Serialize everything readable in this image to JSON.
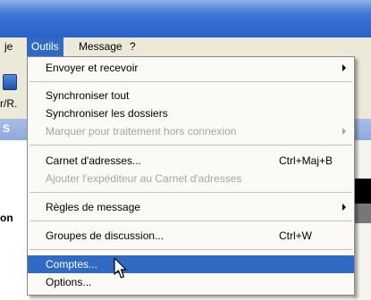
{
  "menubar": {
    "left_fragment": "je",
    "outils": "Outils",
    "message": "Message",
    "help": "?"
  },
  "toolbar": {
    "partial_label": "r/R."
  },
  "strip": {
    "letter": "S"
  },
  "left_pane": {
    "bold_fragment": "on"
  },
  "menu": {
    "items": [
      {
        "label": "Envoyer et recevoir",
        "submenu": true
      },
      {
        "label": "Synchroniser tout"
      },
      {
        "label": "Synchroniser les dossiers"
      },
      {
        "label": "Marquer pour traitement hors connexion",
        "disabled": true,
        "submenu": true
      },
      {
        "label": "Carnet d'adresses...",
        "shortcut": "Ctrl+Maj+B"
      },
      {
        "label": "Ajouter l'expéditeur au Carnet d'adresses",
        "disabled": true
      },
      {
        "label": "Règles de message",
        "submenu": true
      },
      {
        "label": "Groupes de discussion...",
        "shortcut": "Ctrl+W"
      },
      {
        "label": "Comptes...",
        "selected": true
      },
      {
        "label": "Options..."
      }
    ]
  },
  "colors": {
    "selection": "#316ac5",
    "menu_bg": "#fbfaf6",
    "menubar_bg": "#ece9d8",
    "disabled_text": "#a7a59b"
  }
}
